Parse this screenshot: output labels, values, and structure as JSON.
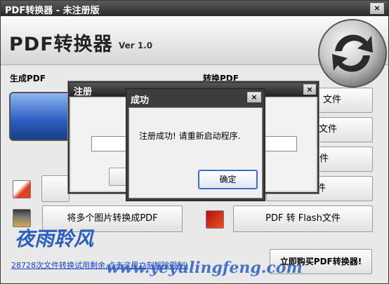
{
  "window": {
    "title": "PDF转换器 - 未注册版",
    "close_glyph": "×"
  },
  "header": {
    "brand": "PDF转换器",
    "version": "Ver 1.0"
  },
  "left_section": {
    "label": "生成PDF",
    "bottom_button": "将多个图片转换成PDF"
  },
  "right_section": {
    "label": "转换PDF",
    "button_suffixes": [
      "文件",
      "文件",
      "文件",
      "文件"
    ],
    "flash_button": "PDF 转 Flash文件"
  },
  "register_dialog": {
    "title": "注册",
    "close_glyph": "×"
  },
  "success_dialog": {
    "title": "成功",
    "close_glyph": "×",
    "message": "注册成功! 请重新启动程序.",
    "ok_label": "确定"
  },
  "footer": {
    "trial_text": "28728次文件转换试用剩余,点击这里立刻解除限制!",
    "buy_button": "立即购买PDF转换器!"
  },
  "watermark": {
    "chinese": "夜雨聆风",
    "url": "www.yeyulingfeng.com"
  },
  "colors": {
    "title_bar": "#2a2a2a",
    "link": "#1840c8",
    "watermark": "#2a5fc0",
    "ok_border": "#3c6fd0"
  }
}
